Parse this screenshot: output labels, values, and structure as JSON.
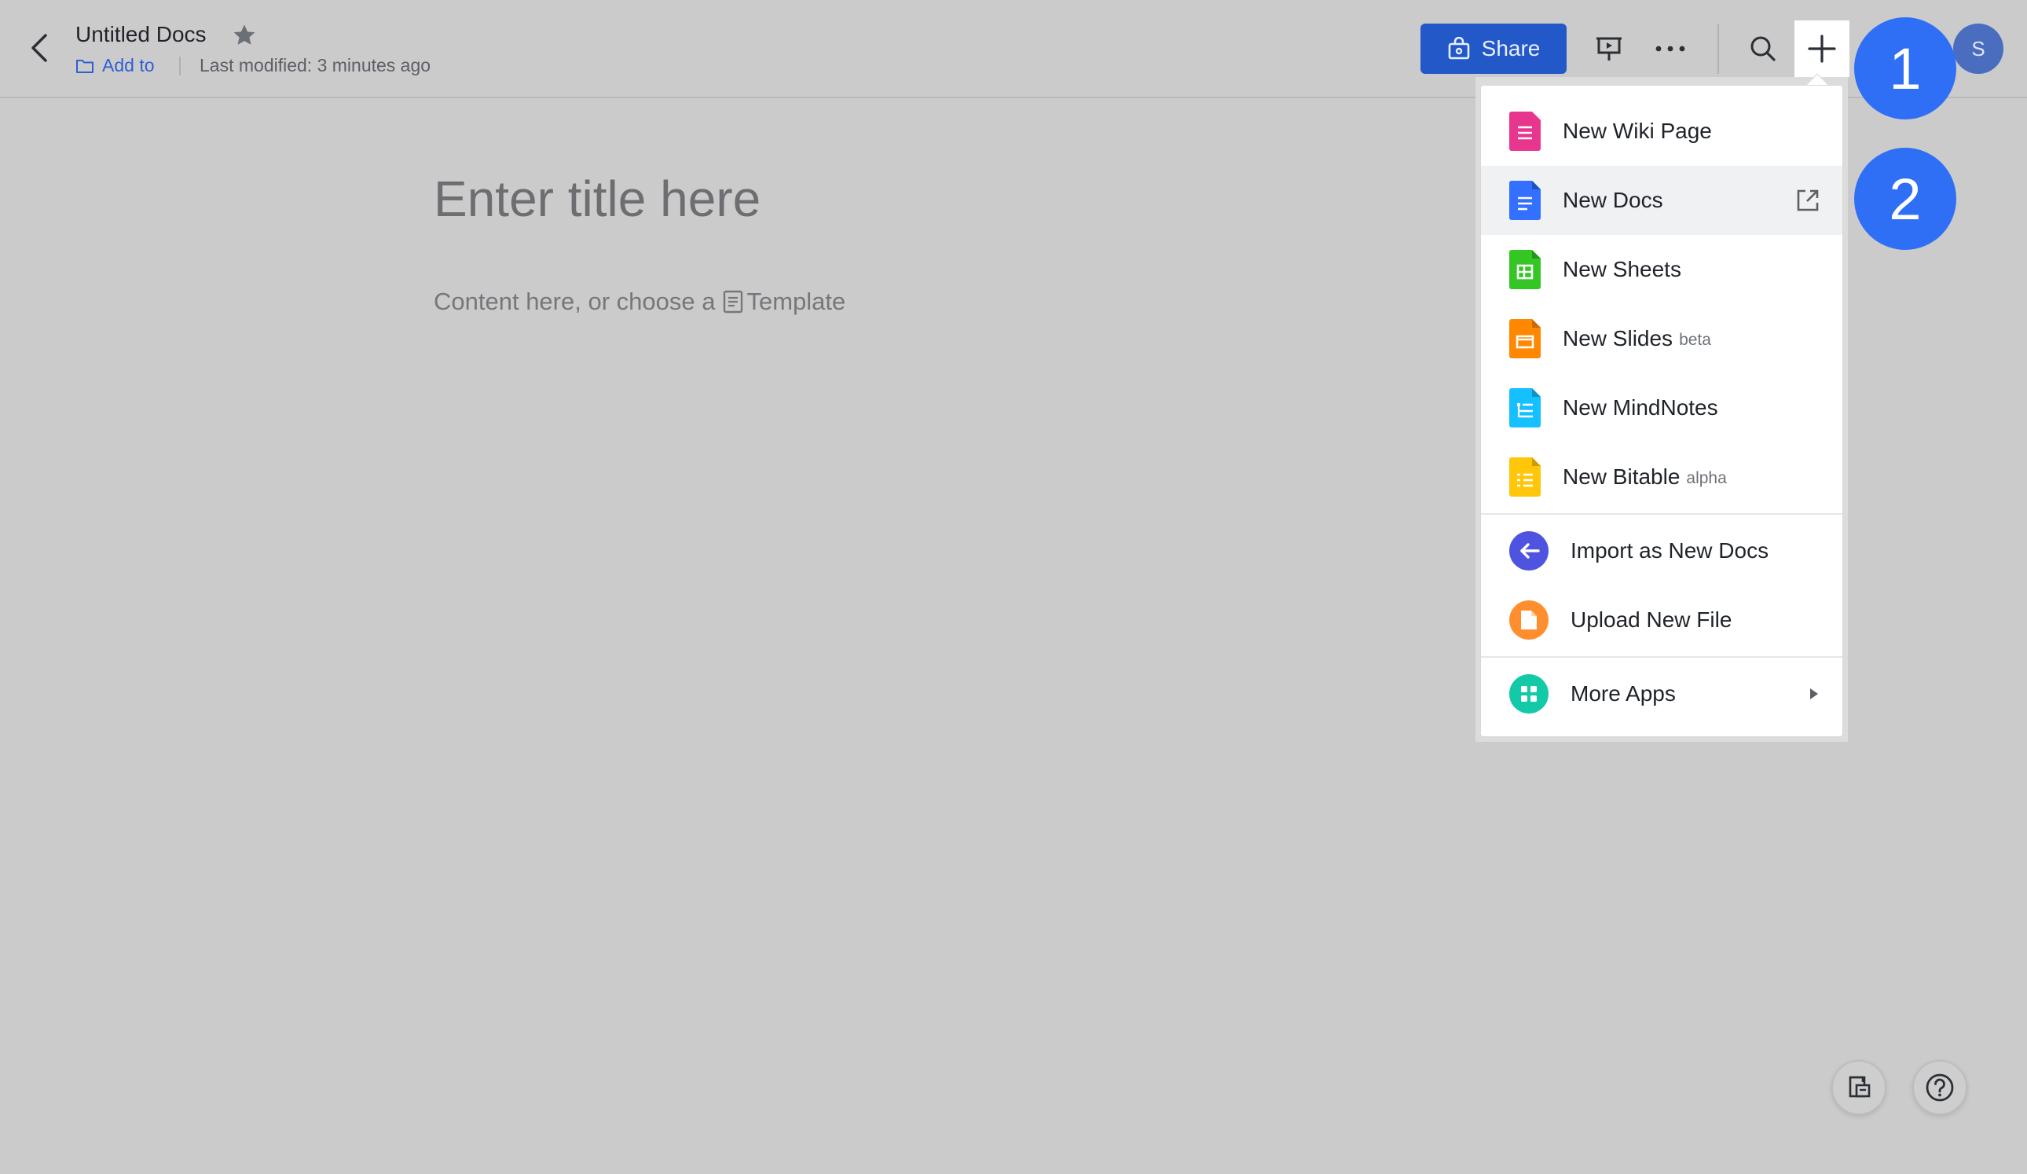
{
  "header": {
    "doc_title": "Untitled Docs",
    "add_to_label": "Add to",
    "last_modified": "Last modified: 3 minutes ago",
    "share_label": "Share",
    "avatar_initial": "S"
  },
  "editor": {
    "title_placeholder": "Enter title here",
    "content_placeholder": "Content here, or choose a",
    "template_label": "Template"
  },
  "badges": {
    "step1": "1",
    "step2": "2"
  },
  "dropdown": {
    "items": [
      {
        "label": "New Wiki Page",
        "tag": "",
        "icon": "wiki-page-icon",
        "color": "#e8368f"
      },
      {
        "label": "New Docs",
        "tag": "",
        "icon": "docs-icon",
        "color": "#3370ff"
      },
      {
        "label": "New Sheets",
        "tag": "",
        "icon": "sheets-icon",
        "color": "#34c724"
      },
      {
        "label": "New Slides",
        "tag": "beta",
        "icon": "slides-icon",
        "color": "#ff8800"
      },
      {
        "label": "New MindNotes",
        "tag": "",
        "icon": "mindnotes-icon",
        "color": "#14c0ff"
      },
      {
        "label": "New Bitable",
        "tag": "alpha",
        "icon": "bitable-icon",
        "color": "#ffc60a"
      },
      {
        "label": "Import as New Docs",
        "tag": "",
        "icon": "import-icon",
        "color": "#4e53e0"
      },
      {
        "label": "Upload New File",
        "tag": "",
        "icon": "upload-file-icon",
        "color": "#ff8f2e"
      },
      {
        "label": "More Apps",
        "tag": "",
        "icon": "more-apps-icon",
        "color": "#14c9a7"
      }
    ]
  },
  "colors": {
    "background": "#cbcbcb",
    "share_button": "#2358c9",
    "step_badge": "#2f6ff6",
    "link": "#2f5ed6"
  }
}
